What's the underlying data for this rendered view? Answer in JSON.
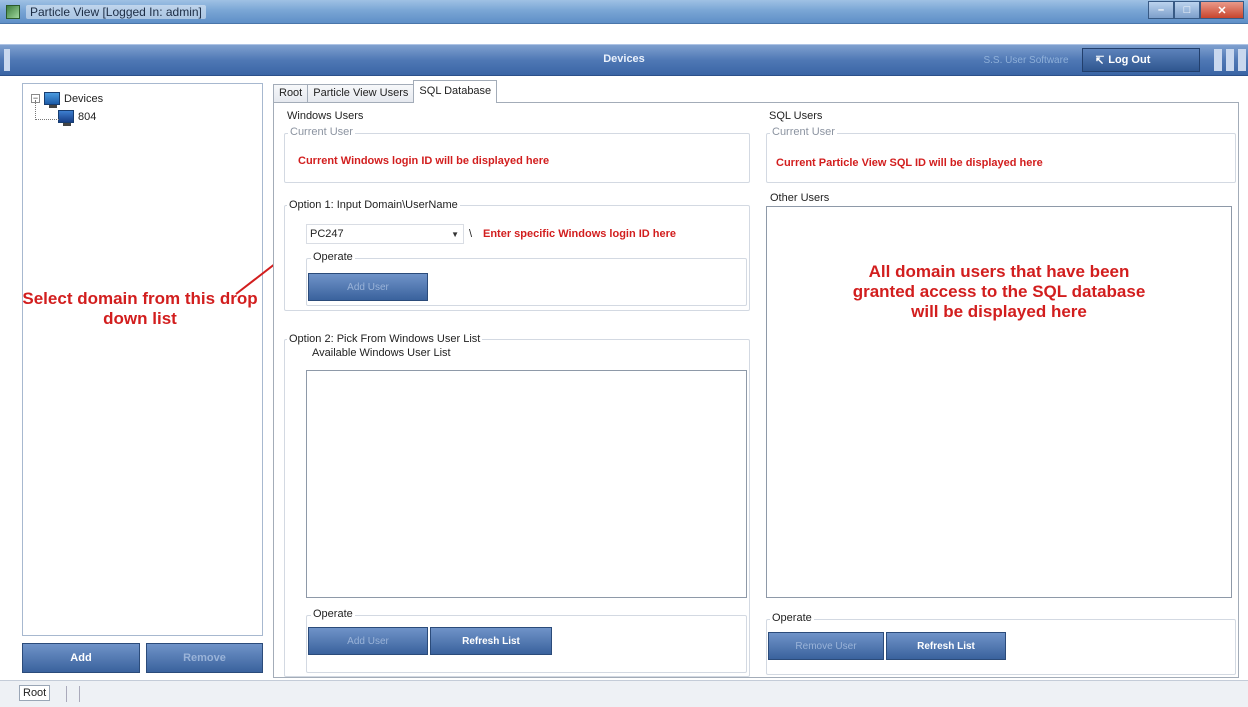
{
  "window": {
    "title": "Particle View [Logged In: admin]",
    "min_glyph": "–",
    "max_glyph": "□",
    "close_glyph": "✕"
  },
  "header": {
    "title": "Devices",
    "faded_button": "S.S. User Software",
    "logout_label": "Log Out",
    "logout_icon": "↸"
  },
  "tree": {
    "root_label": "Devices",
    "expander": "−",
    "child_label": "804"
  },
  "left_buttons": {
    "add_label": "Add",
    "remove_label": "Remove"
  },
  "tabs": [
    {
      "label": "Root"
    },
    {
      "label": "Particle View Users"
    },
    {
      "label": "SQL Database"
    }
  ],
  "windows_users": {
    "group_label": "Windows Users",
    "current_user_label": "Current User",
    "current_user_note": "Current Windows login ID will be displayed here",
    "option1": {
      "label": "Option 1: Input Domain\\UserName",
      "domain_value": "PC247",
      "separator": "\\",
      "username_note": "Enter specific Windows login ID here",
      "operate_label": "Operate",
      "add_user_label": "Add User"
    },
    "option2": {
      "label": "Option 2: Pick From Windows User List",
      "available_label": "Available Windows User List",
      "operate_label": "Operate",
      "add_user_label": "Add User",
      "refresh_label": "Refresh List"
    }
  },
  "sql_users": {
    "group_label": "SQL Users",
    "current_user_label": "Current User",
    "current_user_note": "Current Particle View SQL ID will be displayed here",
    "other_users_label": "Other Users",
    "other_users_note": "All domain users that have been granted access to the SQL database will be displayed here",
    "operate_label": "Operate",
    "remove_user_label": "Remove User",
    "refresh_label": "Refresh List"
  },
  "annotation": {
    "domain_note": "Select domain from this drop down list"
  },
  "status": {
    "root_label": "Root"
  },
  "colors": {
    "annotation_red": "#d21e1e",
    "header_blue": "#3a65a5",
    "button_blue": "#3a629d"
  }
}
